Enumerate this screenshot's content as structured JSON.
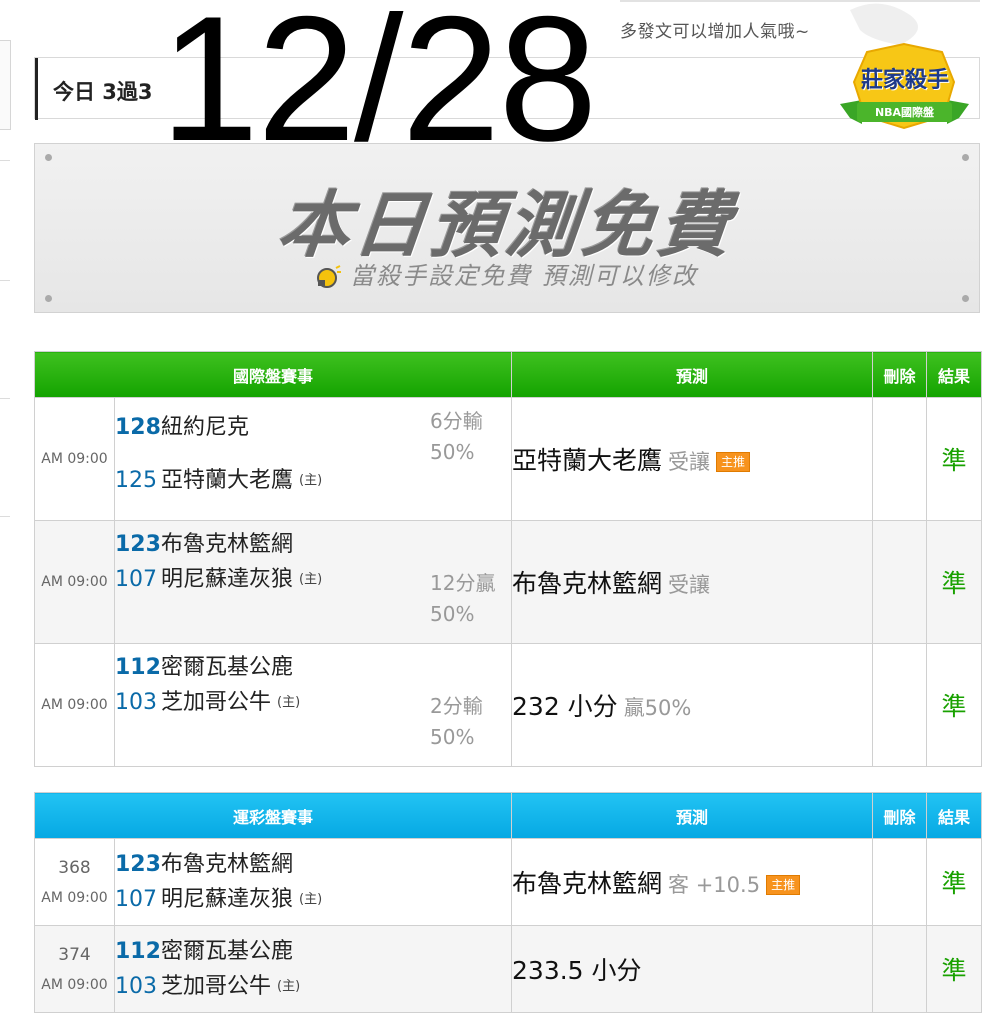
{
  "hint": "多發文可以增加人氣哦~",
  "header": {
    "label": "今日 3過3",
    "date": "12/28"
  },
  "badge": {
    "title": "莊家殺手",
    "subtitle": "NBA國際盤"
  },
  "banner": {
    "title": "本日預測免費",
    "subtitle": "當殺手設定免費  預測可以修改"
  },
  "intl_table": {
    "headers": {
      "event": "國際盤賽事",
      "prediction": "預測",
      "delete": "刪除",
      "result": "結果"
    },
    "rows": [
      {
        "time": "AM 09:00",
        "team1": {
          "num": "128",
          "name": "紐約尼克"
        },
        "team2": {
          "num": "125",
          "name": "亞特蘭大老鷹",
          "home": "(主)"
        },
        "spread_line1": "6分輸",
        "spread_line2": "50%",
        "pick": "亞特蘭大老鷹",
        "pick_note": "受讓",
        "tag": "主推",
        "result": "準"
      },
      {
        "time": "AM 09:00",
        "team1": {
          "num": "123",
          "name": "布魯克林籃網"
        },
        "team2": {
          "num": "107",
          "name": "明尼蘇達灰狼",
          "home": "(主)"
        },
        "spread_line1": "12分贏",
        "spread_line2": "50%",
        "pick": "布魯克林籃網",
        "pick_note": "受讓",
        "result": "準"
      },
      {
        "time": "AM 09:00",
        "team1": {
          "num": "112",
          "name": "密爾瓦基公鹿"
        },
        "team2": {
          "num": "103",
          "name": "芝加哥公牛",
          "home": "(主)"
        },
        "spread_line1": "2分輸",
        "spread_line2": "50%",
        "pick": "232 小分",
        "pick_note": "贏50%",
        "result": "準"
      }
    ]
  },
  "lottery_table": {
    "headers": {
      "event": "運彩盤賽事",
      "prediction": "預測",
      "delete": "刪除",
      "result": "結果"
    },
    "rows": [
      {
        "code": "368",
        "time": "AM 09:00",
        "team1": {
          "num": "123",
          "name": "布魯克林籃網"
        },
        "team2": {
          "num": "107",
          "name": "明尼蘇達灰狼",
          "home": "(主)"
        },
        "pick": "布魯克林籃網",
        "pick_note": "客 +10.5",
        "tag": "主推",
        "result": "準"
      },
      {
        "code": "374",
        "time": "AM 09:00",
        "team1": {
          "num": "112",
          "name": "密爾瓦基公鹿"
        },
        "team2": {
          "num": "103",
          "name": "芝加哥公牛",
          "home": "(主)"
        },
        "pick": "233.5 小分",
        "result": "準"
      }
    ]
  },
  "colors": {
    "intl_header": "#13a300",
    "lottery_header": "#05a8e3",
    "result_green": "#19a100",
    "tag_orange": "#f7931e",
    "team_number_blue": "#0a6aa8"
  }
}
